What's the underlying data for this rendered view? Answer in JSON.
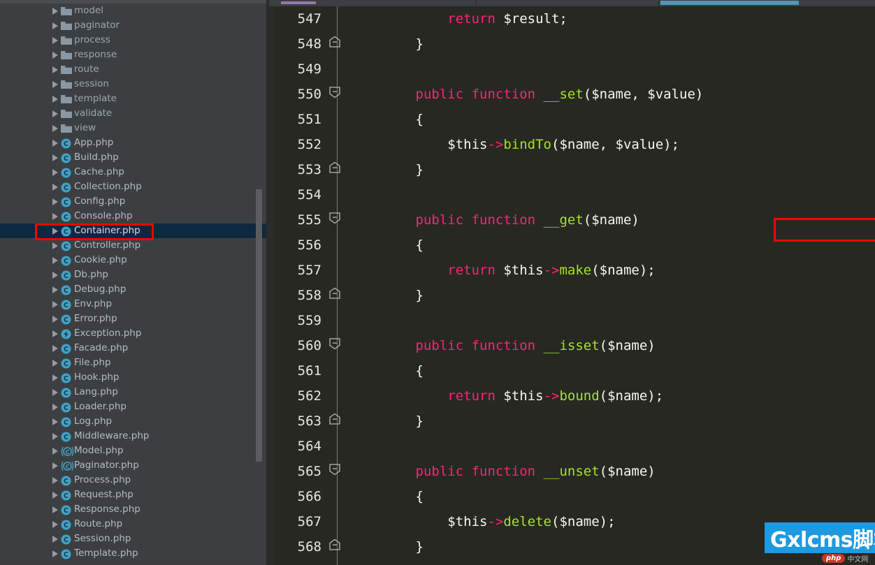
{
  "app": {
    "theme_sidebar_bg": "#3c3f41",
    "theme_editor_bg": "#272822",
    "accent_tab": "#4e9ab5",
    "selection_bg": "#0d293f",
    "annotation_color": "#ff0202"
  },
  "sidebar": {
    "items": [
      {
        "label": "model",
        "icon": "folder-icon",
        "type": "folder",
        "selected": false
      },
      {
        "label": "paginator",
        "icon": "folder-icon",
        "type": "folder",
        "selected": false
      },
      {
        "label": "process",
        "icon": "folder-icon",
        "type": "folder",
        "selected": false
      },
      {
        "label": "response",
        "icon": "folder-icon",
        "type": "folder",
        "selected": false
      },
      {
        "label": "route",
        "icon": "folder-icon",
        "type": "folder",
        "selected": false
      },
      {
        "label": "session",
        "icon": "folder-icon",
        "type": "folder",
        "selected": false
      },
      {
        "label": "template",
        "icon": "folder-icon",
        "type": "folder",
        "selected": false
      },
      {
        "label": "validate",
        "icon": "folder-icon",
        "type": "folder",
        "selected": false
      },
      {
        "label": "view",
        "icon": "folder-icon",
        "type": "folder",
        "selected": false
      },
      {
        "label": "App.php",
        "icon": "php-class-icon",
        "type": "file",
        "selected": false
      },
      {
        "label": "Build.php",
        "icon": "php-class-icon",
        "type": "file",
        "selected": false
      },
      {
        "label": "Cache.php",
        "icon": "php-class-icon",
        "type": "file",
        "selected": false
      },
      {
        "label": "Collection.php",
        "icon": "php-class-icon",
        "type": "file",
        "selected": false
      },
      {
        "label": "Config.php",
        "icon": "php-class-icon",
        "type": "file",
        "selected": false
      },
      {
        "label": "Console.php",
        "icon": "php-class-icon",
        "type": "file",
        "selected": false
      },
      {
        "label": "Container.php",
        "icon": "php-class-icon",
        "type": "file",
        "selected": true
      },
      {
        "label": "Controller.php",
        "icon": "php-class-icon",
        "type": "file",
        "selected": false
      },
      {
        "label": "Cookie.php",
        "icon": "php-class-icon",
        "type": "file",
        "selected": false
      },
      {
        "label": "Db.php",
        "icon": "php-class-icon",
        "type": "file",
        "selected": false
      },
      {
        "label": "Debug.php",
        "icon": "php-class-icon",
        "type": "file",
        "selected": false
      },
      {
        "label": "Env.php",
        "icon": "php-class-icon",
        "type": "file",
        "selected": false
      },
      {
        "label": "Error.php",
        "icon": "php-class-icon",
        "type": "file",
        "selected": false
      },
      {
        "label": "Exception.php",
        "icon": "php-exception-icon",
        "type": "file",
        "selected": false
      },
      {
        "label": "Facade.php",
        "icon": "php-class-icon",
        "type": "file",
        "selected": false
      },
      {
        "label": "File.php",
        "icon": "php-class-icon",
        "type": "file",
        "selected": false
      },
      {
        "label": "Hook.php",
        "icon": "php-class-icon",
        "type": "file",
        "selected": false
      },
      {
        "label": "Lang.php",
        "icon": "php-class-icon",
        "type": "file",
        "selected": false
      },
      {
        "label": "Loader.php",
        "icon": "php-class-icon",
        "type": "file",
        "selected": false
      },
      {
        "label": "Log.php",
        "icon": "php-class-icon",
        "type": "file",
        "selected": false
      },
      {
        "label": "Middleware.php",
        "icon": "php-class-icon",
        "type": "file",
        "selected": false
      },
      {
        "label": "Model.php",
        "icon": "php-abstract-class-icon",
        "type": "file",
        "selected": false
      },
      {
        "label": "Paginator.php",
        "icon": "php-abstract-class-icon",
        "type": "file",
        "selected": false
      },
      {
        "label": "Process.php",
        "icon": "php-class-icon",
        "type": "file",
        "selected": false
      },
      {
        "label": "Request.php",
        "icon": "php-class-icon",
        "type": "file",
        "selected": false
      },
      {
        "label": "Response.php",
        "icon": "php-class-icon",
        "type": "file",
        "selected": false
      },
      {
        "label": "Route.php",
        "icon": "php-class-icon",
        "type": "file",
        "selected": false
      },
      {
        "label": "Session.php",
        "icon": "php-class-icon",
        "type": "file",
        "selected": false
      },
      {
        "label": "Template.php",
        "icon": "php-class-icon",
        "type": "file",
        "selected": false
      }
    ]
  },
  "editor": {
    "lines": [
      {
        "no": "547",
        "fold": "none",
        "tokens": [
          {
            "t": "            ",
            "c": "t-punct"
          },
          {
            "t": "return",
            "c": "t-kw"
          },
          {
            "t": " $result;",
            "c": "t-var"
          }
        ]
      },
      {
        "no": "548",
        "fold": "end",
        "tokens": [
          {
            "t": "        }",
            "c": "t-punct"
          }
        ]
      },
      {
        "no": "549",
        "fold": "none",
        "tokens": []
      },
      {
        "no": "550",
        "fold": "start",
        "tokens": [
          {
            "t": "        ",
            "c": "t-punct"
          },
          {
            "t": "public function",
            "c": "t-kw"
          },
          {
            "t": " ",
            "c": "t-punct"
          },
          {
            "t": "__set",
            "c": "t-fn"
          },
          {
            "t": "($name, $value)",
            "c": "t-var"
          }
        ]
      },
      {
        "no": "551",
        "fold": "none",
        "tokens": [
          {
            "t": "        {",
            "c": "t-punct"
          }
        ]
      },
      {
        "no": "552",
        "fold": "none",
        "tokens": [
          {
            "t": "            $this",
            "c": "t-var"
          },
          {
            "t": "->",
            "c": "t-op"
          },
          {
            "t": "bindTo",
            "c": "t-fn"
          },
          {
            "t": "($name, $value);",
            "c": "t-var"
          }
        ]
      },
      {
        "no": "553",
        "fold": "end",
        "tokens": [
          {
            "t": "        }",
            "c": "t-punct"
          }
        ]
      },
      {
        "no": "554",
        "fold": "none",
        "tokens": []
      },
      {
        "no": "555",
        "fold": "start",
        "tokens": [
          {
            "t": "        ",
            "c": "t-punct"
          },
          {
            "t": "public function",
            "c": "t-kw"
          },
          {
            "t": " ",
            "c": "t-punct"
          },
          {
            "t": "__get",
            "c": "t-fn"
          },
          {
            "t": "($name)",
            "c": "t-var"
          }
        ]
      },
      {
        "no": "556",
        "fold": "none",
        "tokens": [
          {
            "t": "        {",
            "c": "t-punct"
          }
        ]
      },
      {
        "no": "557",
        "fold": "none",
        "tokens": [
          {
            "t": "            ",
            "c": "t-punct"
          },
          {
            "t": "return",
            "c": "t-kw"
          },
          {
            "t": " $this",
            "c": "t-var"
          },
          {
            "t": "->",
            "c": "t-op"
          },
          {
            "t": "make",
            "c": "t-fn"
          },
          {
            "t": "($name);",
            "c": "t-var"
          }
        ]
      },
      {
        "no": "558",
        "fold": "end",
        "tokens": [
          {
            "t": "        }",
            "c": "t-punct"
          }
        ]
      },
      {
        "no": "559",
        "fold": "none",
        "tokens": []
      },
      {
        "no": "560",
        "fold": "start",
        "tokens": [
          {
            "t": "        ",
            "c": "t-punct"
          },
          {
            "t": "public function",
            "c": "t-kw"
          },
          {
            "t": " ",
            "c": "t-punct"
          },
          {
            "t": "__isset",
            "c": "t-fn"
          },
          {
            "t": "($name)",
            "c": "t-var"
          }
        ]
      },
      {
        "no": "561",
        "fold": "none",
        "tokens": [
          {
            "t": "        {",
            "c": "t-punct"
          }
        ]
      },
      {
        "no": "562",
        "fold": "none",
        "tokens": [
          {
            "t": "            ",
            "c": "t-punct"
          },
          {
            "t": "return",
            "c": "t-kw"
          },
          {
            "t": " $this",
            "c": "t-var"
          },
          {
            "t": "->",
            "c": "t-op"
          },
          {
            "t": "bound",
            "c": "t-fn"
          },
          {
            "t": "($name);",
            "c": "t-var"
          }
        ]
      },
      {
        "no": "563",
        "fold": "end",
        "tokens": [
          {
            "t": "        }",
            "c": "t-punct"
          }
        ]
      },
      {
        "no": "564",
        "fold": "none",
        "tokens": []
      },
      {
        "no": "565",
        "fold": "start",
        "tokens": [
          {
            "t": "        ",
            "c": "t-punct"
          },
          {
            "t": "public function",
            "c": "t-kw"
          },
          {
            "t": " ",
            "c": "t-punct"
          },
          {
            "t": "__unset",
            "c": "t-fn"
          },
          {
            "t": "($name)",
            "c": "t-var"
          }
        ]
      },
      {
        "no": "566",
        "fold": "none",
        "tokens": [
          {
            "t": "        {",
            "c": "t-punct"
          }
        ]
      },
      {
        "no": "567",
        "fold": "none",
        "tokens": [
          {
            "t": "            $this",
            "c": "t-var"
          },
          {
            "t": "->",
            "c": "t-op"
          },
          {
            "t": "delete",
            "c": "t-fn"
          },
          {
            "t": "($name);",
            "c": "t-var"
          }
        ]
      },
      {
        "no": "568",
        "fold": "end",
        "tokens": [
          {
            "t": "        }",
            "c": "t-punct"
          }
        ]
      }
    ],
    "highlighted_symbol": "__get($name)"
  },
  "watermark": {
    "text": "Gxlcms脚本",
    "badge_label": "php",
    "badge_suffix": "中文网"
  }
}
